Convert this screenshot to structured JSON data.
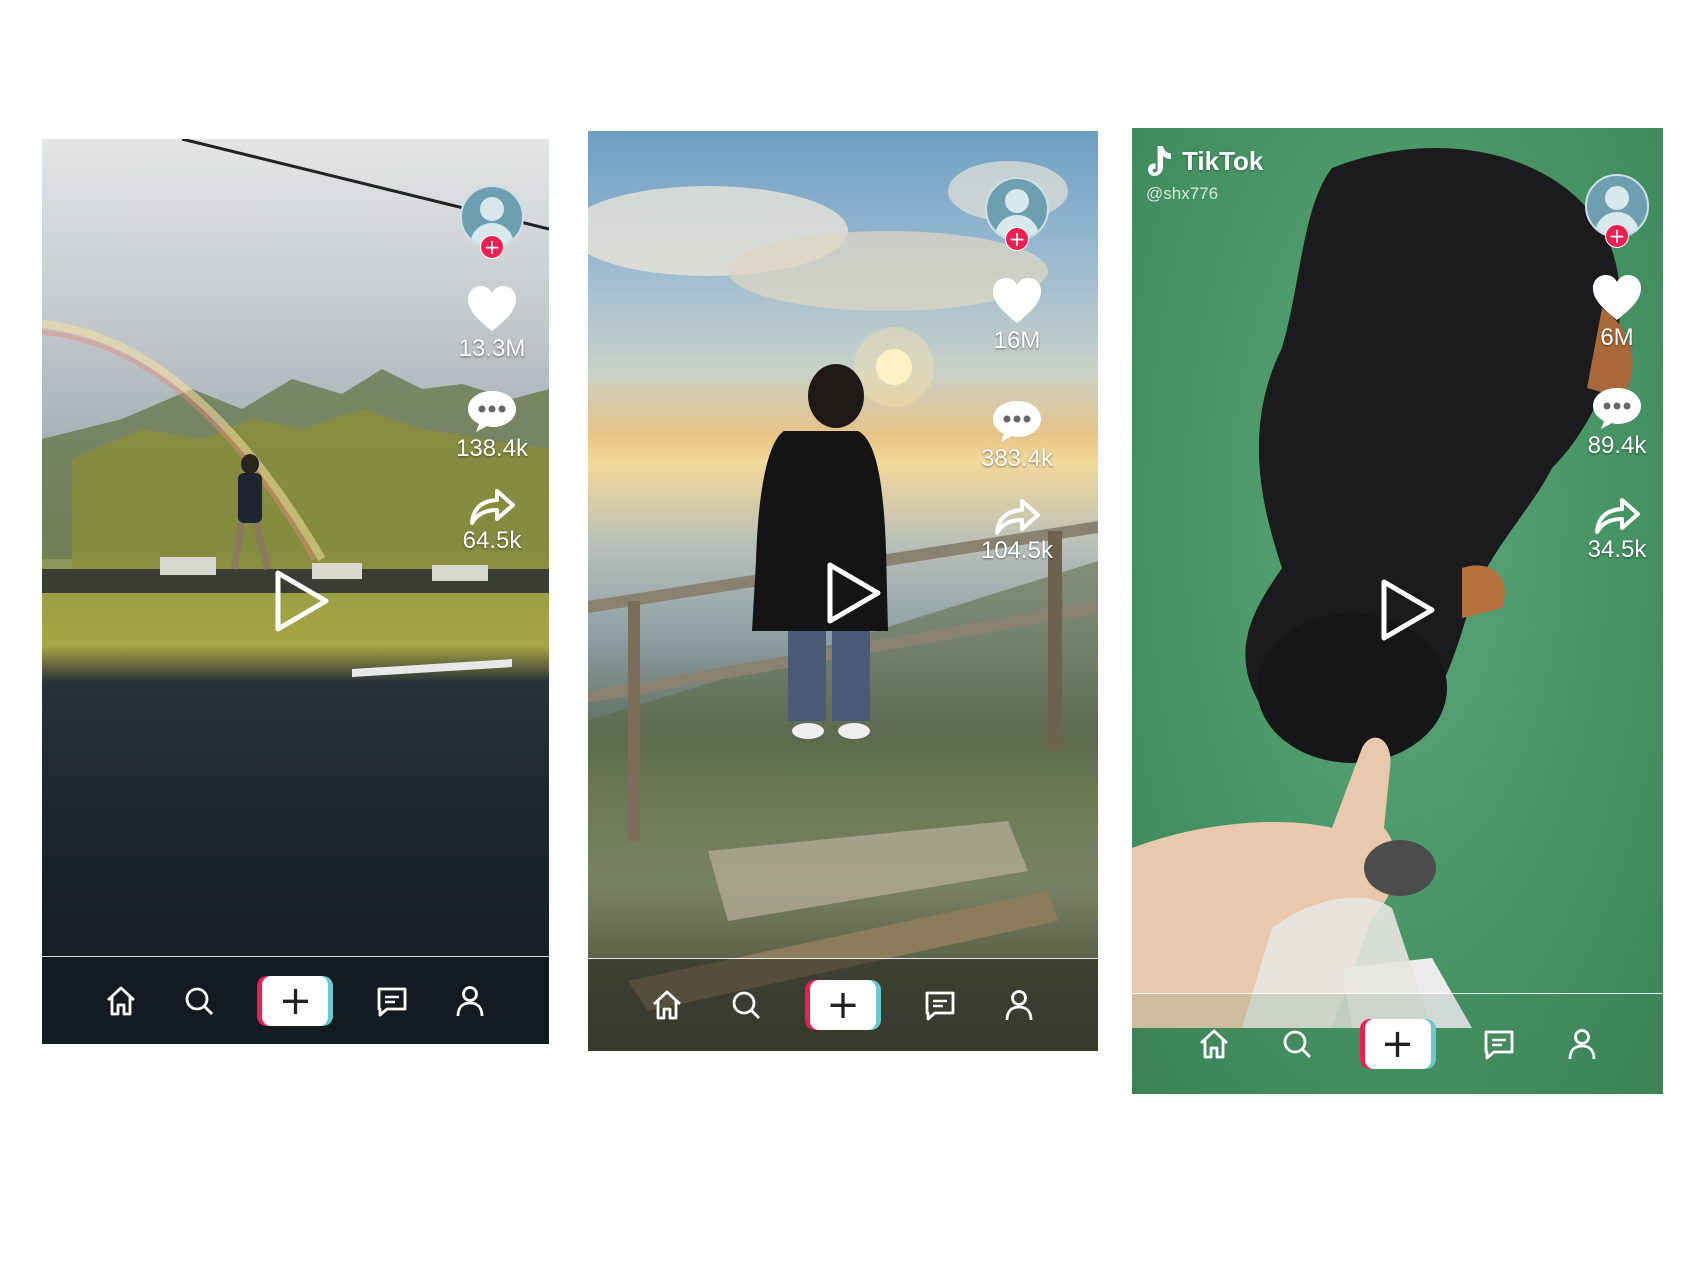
{
  "phones": [
    {
      "scene": "road-rainbow",
      "stats": {
        "likes": "13.3M",
        "comments": "138.4k",
        "shares": "64.5k"
      },
      "icons": {
        "avatar": "profile-avatar",
        "follow": "plus-icon",
        "like": "heart-icon",
        "comment": "comment-bubble-icon",
        "share": "share-arrow-icon",
        "play": "play-icon"
      }
    },
    {
      "scene": "sunset-lake-railing",
      "stats": {
        "likes": "16M",
        "comments": "383.4k",
        "shares": "104.5k"
      },
      "icons": {
        "avatar": "profile-avatar",
        "follow": "plus-icon",
        "like": "heart-icon",
        "comment": "comment-bubble-icon",
        "share": "share-arrow-icon",
        "play": "play-icon"
      }
    },
    {
      "scene": "dog-on-grass",
      "watermark": {
        "brand": "TikTok",
        "handle": "@shx776"
      },
      "stats": {
        "likes": "6M",
        "comments": "89.4k",
        "shares": "34.5k"
      },
      "icons": {
        "avatar": "profile-avatar",
        "follow": "plus-icon",
        "like": "heart-icon",
        "comment": "comment-bubble-icon",
        "share": "share-arrow-icon",
        "play": "play-icon"
      }
    }
  ],
  "navbar": {
    "items": [
      "home-icon",
      "search-icon",
      "create-plus-icon",
      "inbox-icon",
      "profile-icon"
    ],
    "create_label": "+"
  },
  "colors": {
    "accent_red": "#ee1d52",
    "accent_cyan": "#69c9d0",
    "icon_white": "#ffffff"
  }
}
